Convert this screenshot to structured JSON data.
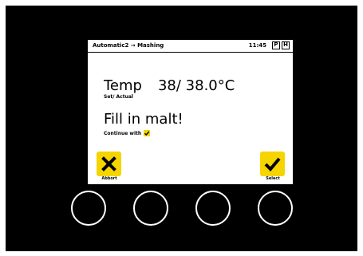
{
  "status_bar": {
    "title": "Automatic2 → Mashing",
    "time": "11:45",
    "mode_icons": [
      "P",
      "H"
    ]
  },
  "temperature": {
    "label": "Temp",
    "value": "38/ 38.0°C",
    "sub": "Set/ Actual"
  },
  "message": {
    "text": "Fill in malt!",
    "sub": "Continue with"
  },
  "soft_keys": {
    "abort_label": "Abbort",
    "select_label": "Select",
    "accent_color": "#f5d400"
  },
  "hardware_buttons": [
    "button-1",
    "button-2",
    "button-3",
    "button-4"
  ]
}
